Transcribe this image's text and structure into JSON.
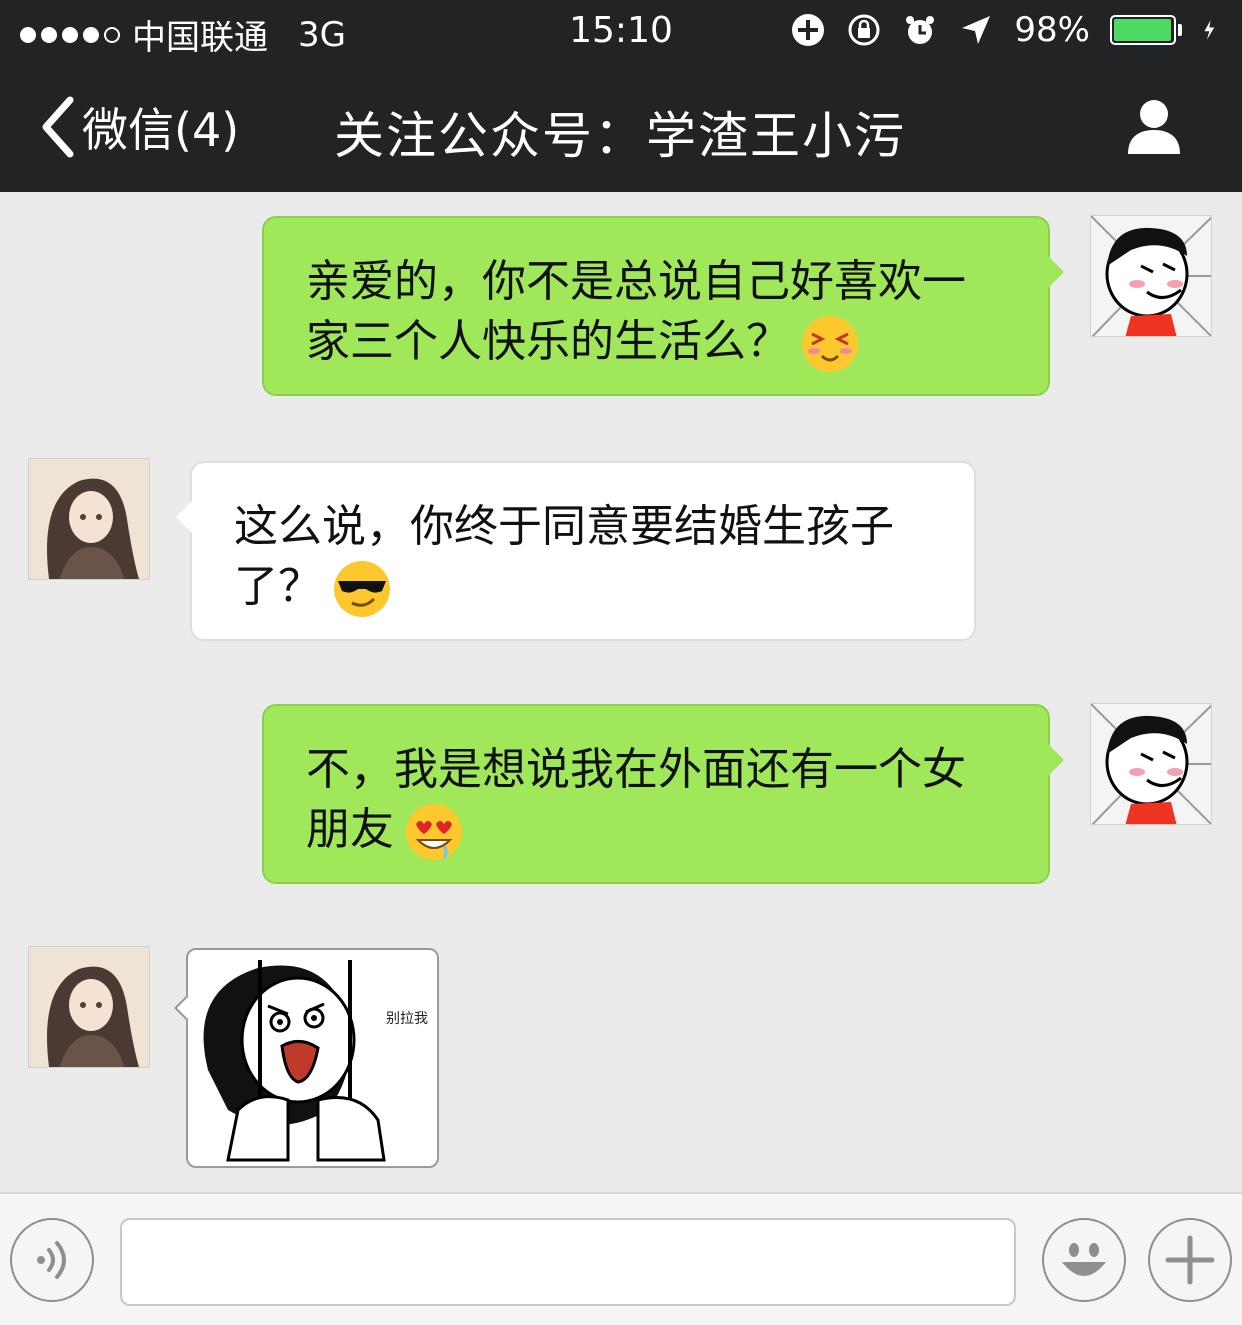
{
  "status_bar": {
    "carrier": "中国联通",
    "network": "3G",
    "time": "15:10",
    "battery_percent": "98%",
    "battery_level": 0.98,
    "signal_bars": 4,
    "icons": [
      "rotation-lock-icon",
      "orientation-lock-icon",
      "alarm-icon",
      "location-arrow-icon",
      "battery-icon",
      "charging-icon"
    ]
  },
  "nav": {
    "back_label": "微信(4)",
    "title": "关注公众号：学渣王小污"
  },
  "messages": [
    {
      "from": "me",
      "text": "亲爱的，你不是总说自己好喜欢一家三个人快乐的生活么？",
      "emoji": "squinting-face-emoji"
    },
    {
      "from": "them",
      "text": "这么说，你终于同意要结婚生孩子了？",
      "emoji": "sunglasses-face-emoji"
    },
    {
      "from": "me",
      "text": "不，我是想说我在外面还有一个女朋友",
      "emoji": "heart-eyes-drool-emoji"
    },
    {
      "from": "them",
      "sticker_text": "别拉我"
    }
  ],
  "input_bar": {
    "text": "",
    "icons": [
      "voice-icon",
      "emoji-icon",
      "plus-icon"
    ]
  },
  "colors": {
    "header_bg": "#222325",
    "chat_bg": "#ebebeb",
    "my_bubble": "#a0e75a",
    "their_bubble": "#ffffff",
    "battery_fill": "#4cd964"
  }
}
